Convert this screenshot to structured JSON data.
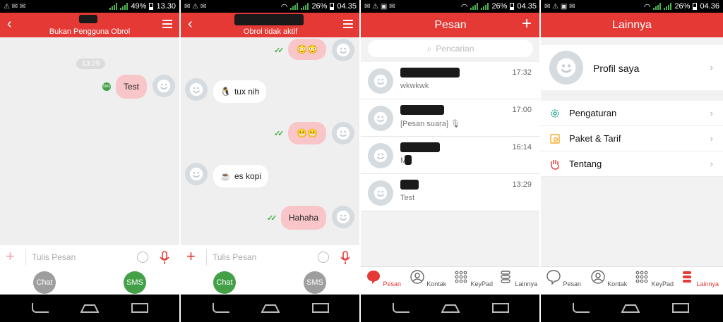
{
  "panel1": {
    "status": {
      "battery": "49%",
      "time": "13.30"
    },
    "subtitle": "Bukan Pengguna Obrol",
    "time_chip": "13:29",
    "outgoing_text": "Test",
    "sms_badge": "SMS",
    "composer_placeholder": "Tulis Pesan",
    "switch_chat": "Chat",
    "switch_sms": "SMS"
  },
  "panel2": {
    "status": {
      "battery": "26%",
      "time": "04.35"
    },
    "subtitle": "Obrol tidak aktif",
    "msg_tux": "tux nih",
    "msg_kopi": "es kopi",
    "msg_hahaha": "Hahaha",
    "composer_placeholder": "Tulis Pesan",
    "switch_chat": "Chat",
    "switch_sms": "SMS"
  },
  "panel3": {
    "status": {
      "battery": "26%",
      "time": "04.35"
    },
    "title": "Pesan",
    "search_placeholder": "Pencarian",
    "conversations": [
      {
        "time": "17:32",
        "preview": "wkwkwk"
      },
      {
        "time": "17:00",
        "preview": "[Pesan suara]"
      },
      {
        "time": "16:14",
        "preview": "M"
      },
      {
        "time": "13:29",
        "preview": "Test"
      }
    ],
    "tabs": [
      "Pesan",
      "Kontak",
      "KeyPad",
      "Lainnya"
    ]
  },
  "panel4": {
    "status": {
      "battery": "26%",
      "time": "04.36"
    },
    "title": "Lainnya",
    "profile": "Profil saya",
    "items": [
      "Pengaturan",
      "Paket & Tarif",
      "Tentang"
    ],
    "tabs": [
      "Pesan",
      "Kontak",
      "KeyPad",
      "Lainnya"
    ]
  },
  "colors": {
    "accent": "#e53935",
    "bubble_out": "#f8c6c8",
    "green": "#43a047"
  }
}
